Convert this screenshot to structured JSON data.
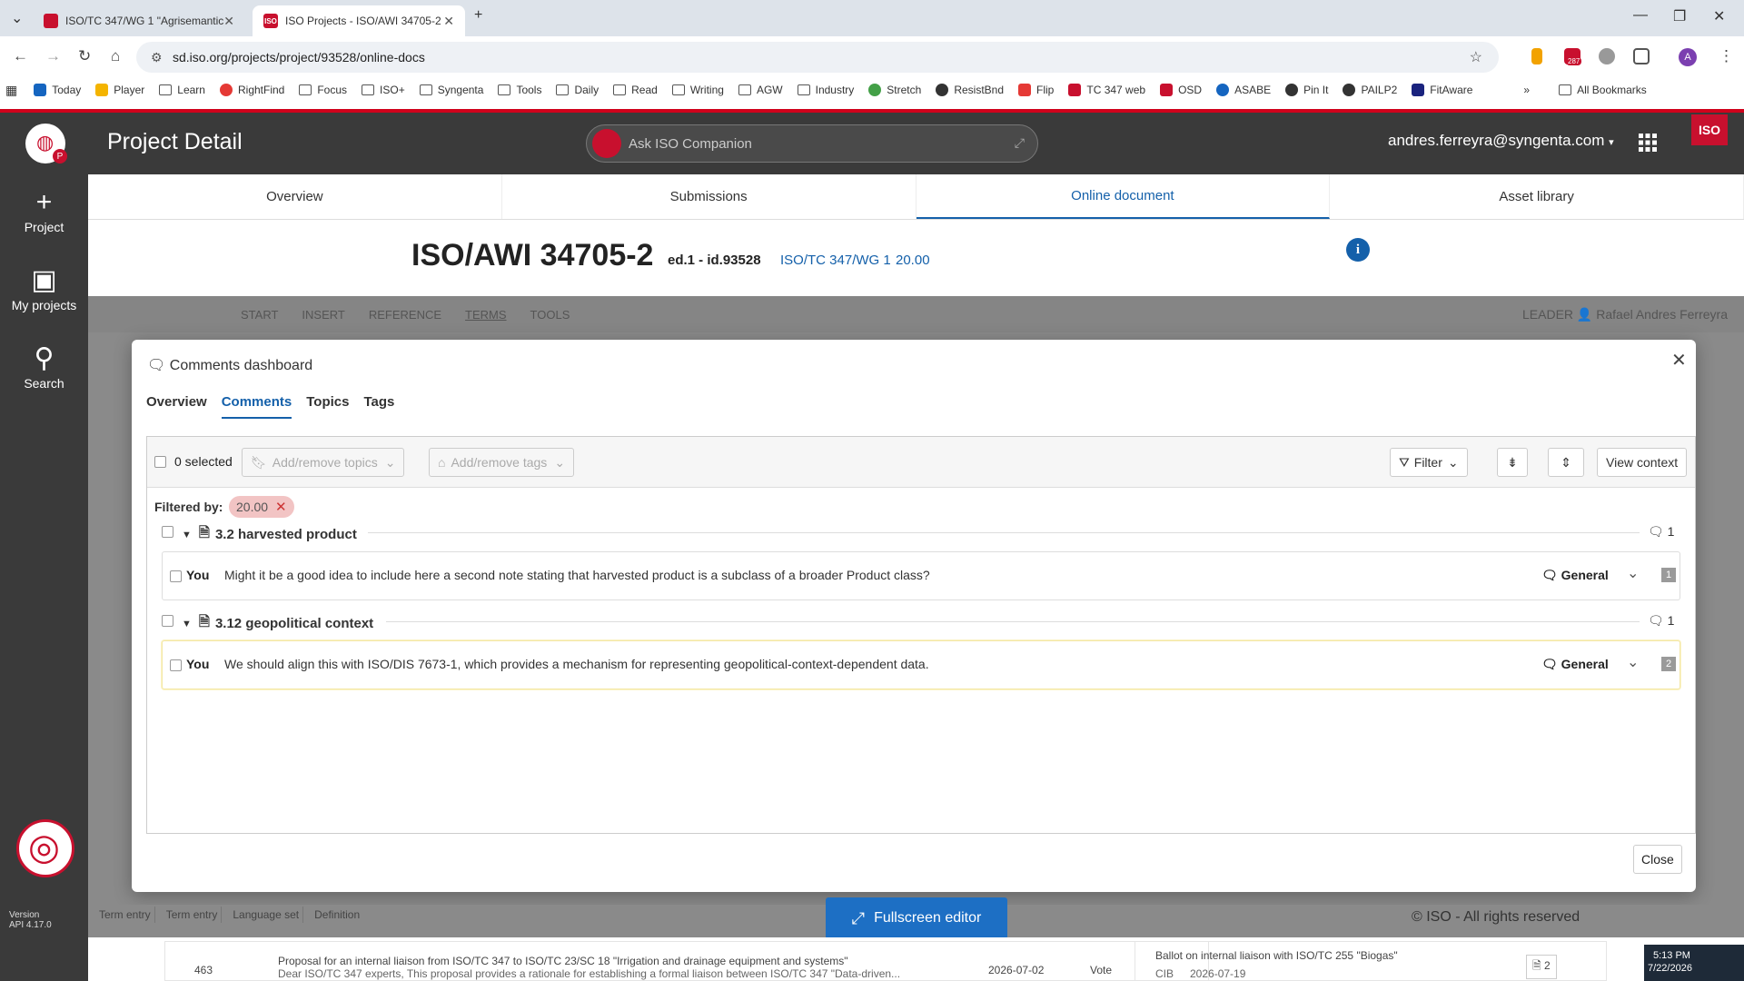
{
  "browser": {
    "tabs": [
      {
        "title": "ISO/TC 347/WG 1 \"Agrisemantics",
        "active": false
      },
      {
        "title": "ISO Projects - ISO/AWI 34705-2",
        "active": true
      }
    ],
    "url": "sd.iso.org/projects/project/93528/online-docs",
    "profile_initial": "A",
    "extension_badge": "287",
    "bookmarks": [
      "Today",
      "Player",
      "Learn",
      "RightFind",
      "Focus",
      "ISO+",
      "Syngenta",
      "Tools",
      "Daily",
      "Read",
      "Writing",
      "AGW",
      "Industry",
      "Stretch",
      "ResistBnd",
      "Flip",
      "TC 347 web",
      "OSD",
      "ASABE",
      "Pin It",
      "PAILP2",
      "FitAware"
    ],
    "all_bookmarks": "All Bookmarks"
  },
  "app": {
    "page_title": "Project Detail",
    "companion_placeholder": "Ask ISO Companion",
    "user": "andres.ferreyra@syngenta.com",
    "logo_text": "ISO",
    "sidebar": [
      {
        "label": "Project",
        "icon": "plus-icon"
      },
      {
        "label": "My projects",
        "icon": "inbox-icon"
      },
      {
        "label": "Search",
        "icon": "search-icon"
      }
    ],
    "sidebar_badge": "P",
    "version_label": "Version",
    "version": "API 4.17.0"
  },
  "nav_tabs": [
    {
      "label": "Overview",
      "selected": false
    },
    {
      "label": "Submissions",
      "selected": false
    },
    {
      "label": "Online document",
      "selected": true
    },
    {
      "label": "Asset library",
      "selected": false
    }
  ],
  "document": {
    "id": "ISO/AWI 34705-2",
    "edition": "ed.1 - id.93528",
    "committee": "ISO/TC 347/WG 1",
    "stage": "20.00"
  },
  "ribbon": {
    "menus": [
      "START",
      "INSERT",
      "REFERENCE",
      "TERMS",
      "TOOLS"
    ],
    "leader_label": "LEADER",
    "leader_name": "Rafael Andres Ferreyra"
  },
  "dashboard": {
    "title": "Comments dashboard",
    "tabs": [
      {
        "label": "Overview",
        "selected": false
      },
      {
        "label": "Comments",
        "selected": true
      },
      {
        "label": "Topics",
        "selected": false
      },
      {
        "label": "Tags",
        "selected": false
      }
    ],
    "toolbar": {
      "selected": "0 selected",
      "add_topics": "Add/remove topics",
      "add_tags": "Add/remove tags",
      "filter": "Filter",
      "view_context": "View context"
    },
    "filtered_by_label": "Filtered by:",
    "filter_chip": "20.00",
    "sections": [
      {
        "title": "3.2 harvested product",
        "count": "1",
        "comments": [
          {
            "author": "You",
            "text": "Might it be a good idea to include here a second note stating that harvested product is a subclass of a broader Product class?",
            "category": "General",
            "number": "1"
          }
        ]
      },
      {
        "title": "3.12 geopolitical context",
        "count": "1",
        "comments": [
          {
            "author": "You",
            "text": "We should align this with ISO/DIS 7673-1, which provides a mechanism for representing geopolitical-context-dependent data.",
            "category": "General",
            "number": "2"
          }
        ]
      }
    ],
    "close_label": "Close"
  },
  "footer": {
    "fullscreen": "Fullscreen editor",
    "copyright": "© ISO - All rights reserved",
    "breadcrumb": [
      "Term entry",
      "Term entry",
      "Language set",
      "Definition"
    ],
    "list_row": {
      "number": "463",
      "title": "Proposal for an internal liaison from ISO/TC 347 to ISO/TC 23/SC 18 \"Irrigation and drainage equipment and systems\"",
      "subtitle": "Dear ISO/TC 347 experts, This proposal provides a rationale for establishing a formal liaison between ISO/TC 347 \"Data-driven...",
      "date": "2026-07-02",
      "type": "Vote"
    },
    "ballot": {
      "title": "Ballot on internal liaison with ISO/TC 255 \"Biogas\"",
      "meta": "CIB",
      "date": "2026-07-19",
      "count": "2"
    }
  },
  "taskbar": {
    "time": "5:13 PM",
    "date": "7/22/2026"
  },
  "colors": {
    "accent": "#1460aa",
    "iso_red": "#c8102e",
    "header_bg": "#3a3a3a",
    "chip": "#f2c4c4"
  }
}
